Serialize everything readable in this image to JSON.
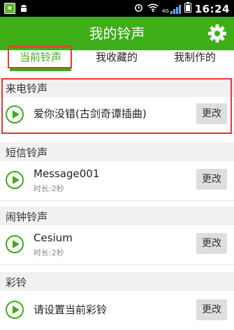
{
  "status_bar": {
    "time": "16:24",
    "network": "4G",
    "icons": [
      "app-icon",
      "android-icon",
      "alarm-icon",
      "wifi-icon",
      "signal-icon",
      "battery-icon"
    ]
  },
  "header": {
    "title": "我的铃声",
    "settings_icon": "gear-icon"
  },
  "tabs": [
    {
      "label": "当前铃声",
      "active": true
    },
    {
      "label": "我收藏的",
      "active": false
    },
    {
      "label": "我制作的",
      "active": false
    }
  ],
  "sections": [
    {
      "title": "来电铃声",
      "item": {
        "name": "爱你没错(古剑奇谭插曲)",
        "sub": "",
        "button": "更改"
      }
    },
    {
      "title": "短信铃声",
      "item": {
        "name": "Message001",
        "sub": "时长:2秒",
        "button": "更改"
      }
    },
    {
      "title": "闹钟铃声",
      "item": {
        "name": "Cesium",
        "sub": "时长:2秒",
        "button": "更改"
      }
    },
    {
      "title": "彩铃",
      "item": {
        "name": "请设置当前彩铃",
        "sub": "",
        "button": "更改"
      }
    }
  ],
  "colors": {
    "accent": "#3dad18",
    "highlight": "#e53935"
  }
}
